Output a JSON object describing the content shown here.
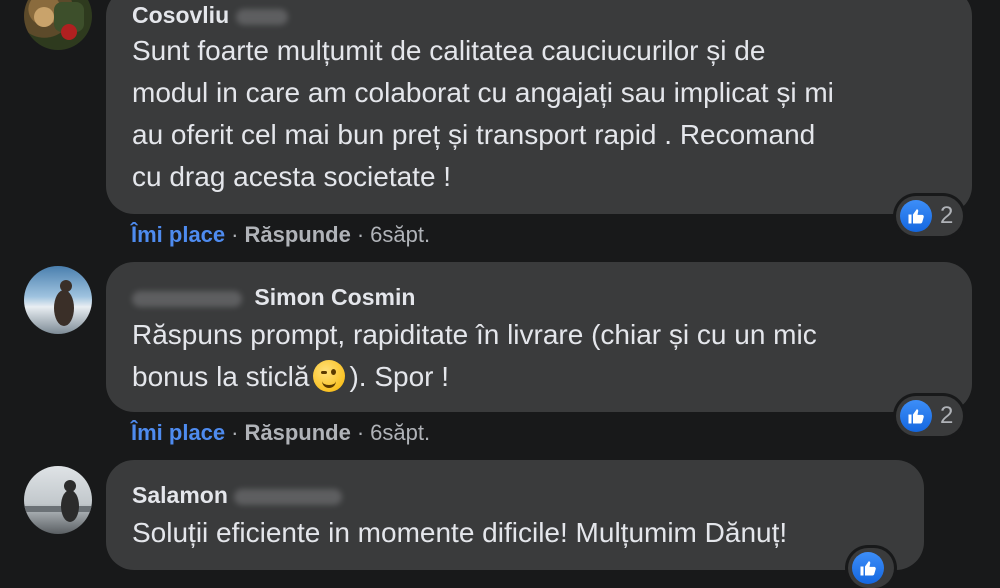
{
  "comments": [
    {
      "author": "Cosovliu",
      "text_lines": [
        "Sunt foarte mulțumit de calitatea cauciucurilor și de",
        "modul in care am colaborat cu angajați sau implicat și mi",
        "au oferit cel mai bun preț și transport rapid . Recomand",
        "cu drag acesta societate !"
      ],
      "like_label": "Îmi place",
      "reply_label": "Răspunde",
      "separator": "·",
      "time": "6săpt.",
      "reaction_count": "2"
    },
    {
      "author": "Simon Cosmin",
      "text_lines": [
        "Răspuns prompt, rapiditate în livrare (chiar și cu un mic",
        "bonus la sticlă",
        "). Spor !"
      ],
      "like_label": "Îmi place",
      "reply_label": "Răspunde",
      "separator": "·",
      "time": "6săpt.",
      "reaction_count": "2"
    },
    {
      "author": "Salamon",
      "text_lines": [
        "Soluții eficiente in momente dificile! Mulțumim Dănuț!"
      ]
    }
  ],
  "icons": {
    "like": "thumbs-up-icon",
    "emoji": "wink-emoji-icon"
  },
  "colors": {
    "background": "#18191a",
    "bubble": "#3a3b3c",
    "like_blue": "#4e8bef",
    "text": "#e4e6eb",
    "muted": "#b0b3b8"
  }
}
